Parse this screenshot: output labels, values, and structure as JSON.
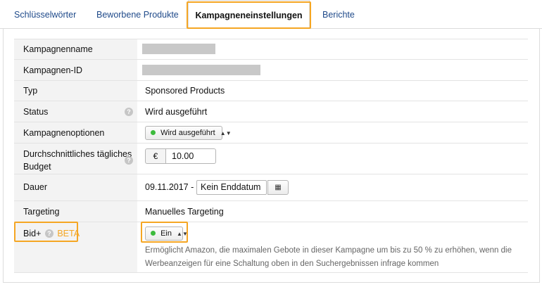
{
  "tabs": {
    "keywords": "Schlüsselwörter",
    "products": "Beworbene Produkte",
    "settings": "Kampagneneinstellungen",
    "reports": "Berichte"
  },
  "fields": {
    "name_label": "Kampagnenname",
    "id_label": "Kampagnen-ID",
    "type_label": "Typ",
    "type_value": "Sponsored Products",
    "status_label": "Status",
    "status_value": "Wird ausgeführt",
    "options_label": "Kampagnenoptionen",
    "options_value": "Wird ausgeführt",
    "budget_label_line1": "Durchschnittliches tägliches",
    "budget_label_line2": "Budget",
    "budget_currency": "€",
    "budget_value": "10.00",
    "duration_label": "Dauer",
    "start_date": "09.11.2017 -",
    "end_date": "Kein Enddatum",
    "targeting_label": "Targeting",
    "targeting_value": "Manuelles Targeting",
    "bid_label": "Bid+",
    "bid_beta": "BETA",
    "bid_value": "Ein",
    "bid_desc_line1": "Ermöglicht Amazon, die maximalen Gebote in dieser Kampagne um bis zu 50 % zu erhöhen, wenn die",
    "bid_desc_line2": "Werbeanzeigen für eine Schaltung oben in den Suchergebnissen infrage kommen"
  },
  "icons": {
    "help": "question-icon",
    "calendar": "calendar-icon",
    "status_dot": "green-dot"
  },
  "colors": {
    "accent_highlight": "#f5a623",
    "link_blue": "#1f4a8a",
    "status_green": "#3dbb3d"
  }
}
